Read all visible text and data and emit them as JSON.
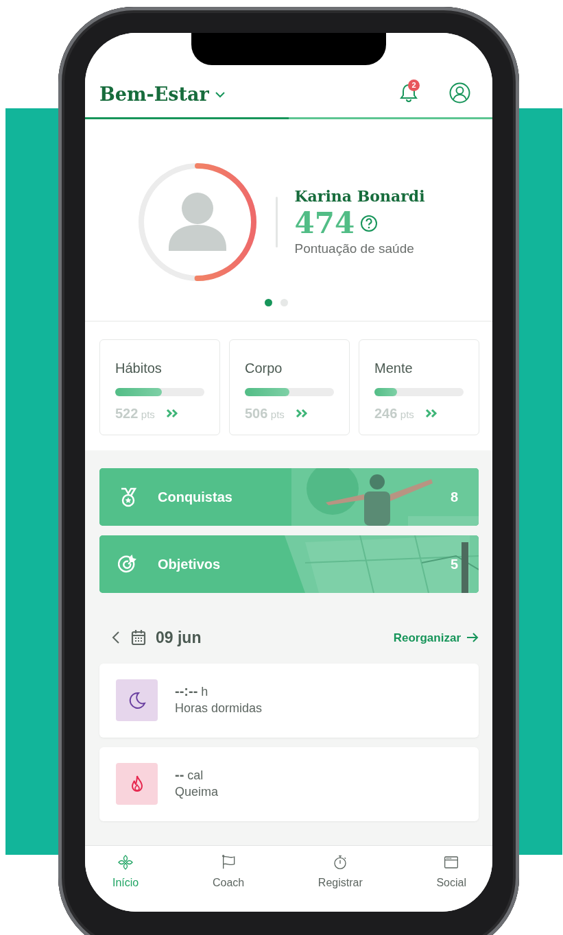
{
  "header": {
    "title": "Bem-Estar",
    "notification_count": "2"
  },
  "page_indicator": {
    "level": 0.5
  },
  "profile": {
    "name": "Karina Bonardi",
    "score": "474",
    "score_label": "Pontuação de saúde",
    "ring": {
      "level": 0.5
    }
  },
  "carousel_dots": [
    {
      "selected": true
    },
    {
      "selected": false
    }
  ],
  "categories": [
    {
      "title": "Hábitos",
      "level": 0.52,
      "points": "522",
      "unit": "pts"
    },
    {
      "title": "Corpo",
      "level": 0.5,
      "points": "506",
      "unit": "pts"
    },
    {
      "title": "Mente",
      "level": 0.25,
      "points": "246",
      "unit": "pts"
    }
  ],
  "banners": [
    {
      "kind": "achievements",
      "label": "Conquistas",
      "count": "8"
    },
    {
      "kind": "goals",
      "label": "Objetivos",
      "count": "5"
    }
  ],
  "date_nav": {
    "date": "09 jun",
    "action": "Reorganizar"
  },
  "trackers": [
    {
      "kind": "sleep",
      "value": "--:--",
      "unit": "h",
      "label": "Horas dormidas"
    },
    {
      "kind": "burn",
      "value": "--",
      "unit": "cal",
      "label": "Queima"
    }
  ],
  "nav": [
    {
      "kind": "home",
      "label": "Início",
      "selected": true
    },
    {
      "kind": "coach",
      "label": "Coach",
      "selected": false
    },
    {
      "kind": "log",
      "label": "Registrar",
      "selected": false
    },
    {
      "kind": "social",
      "label": "Social",
      "selected": false
    }
  ]
}
